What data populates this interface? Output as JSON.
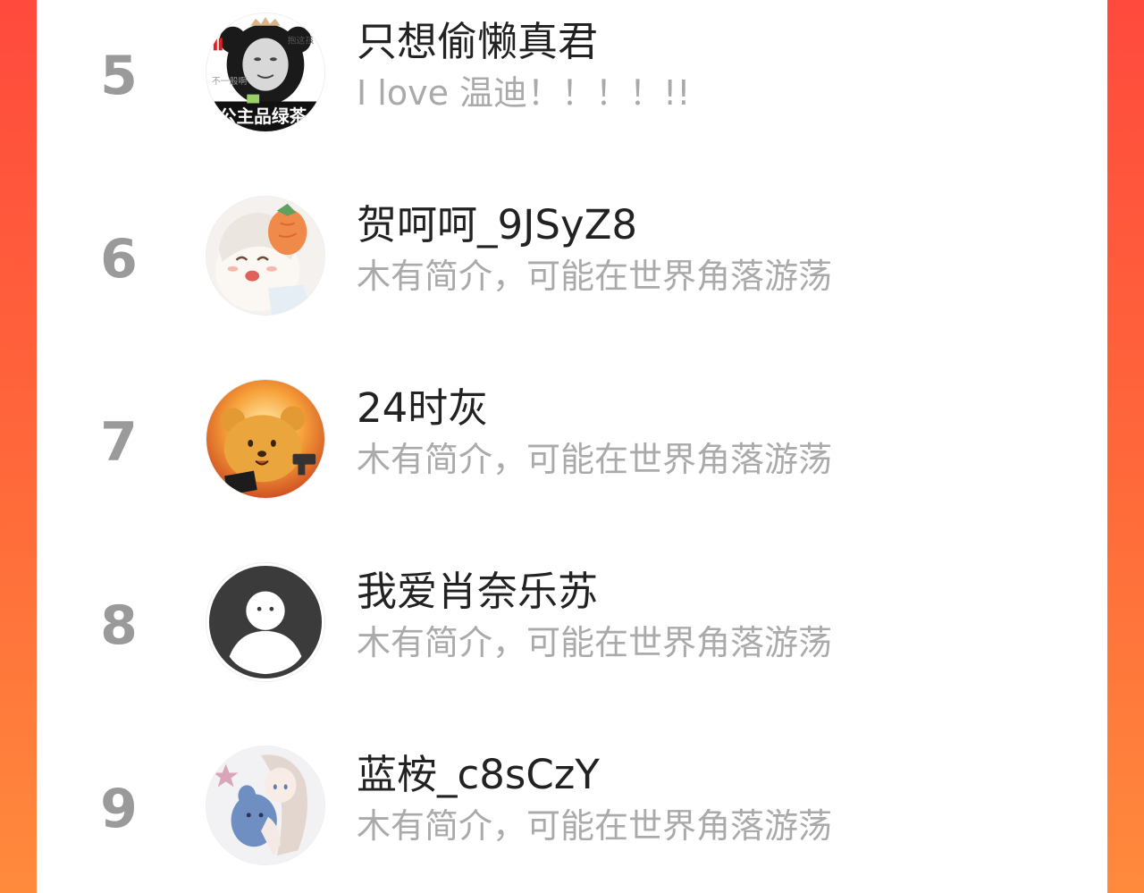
{
  "colors": {
    "background_gradient_top": "#ff4a3d",
    "background_gradient_bottom": "#ff8a3c",
    "card": "#ffffff",
    "rank_text": "#9a9a9a",
    "name_text": "#222222",
    "bio_text": "#aaaaaa"
  },
  "ranking": [
    {
      "rank": "5",
      "name": "只想偷懒真君",
      "bio": "I love 温迪！！！！!!",
      "avatar_icon": "panda-meme-avatar-icon",
      "avatar_text": {
        "top": "抱这孩",
        "left": "不一般啊",
        "bottom": "公主品绿茶"
      }
    },
    {
      "rank": "6",
      "name": "贺呵呵_9JSyZ8",
      "bio": "木有简介，可能在世界角落游荡",
      "avatar_icon": "anime-girl-carrot-avatar-icon"
    },
    {
      "rank": "7",
      "name": "24时灰",
      "bio": "木有简介，可能在世界角落游荡",
      "avatar_icon": "bear-with-gun-fire-avatar-icon"
    },
    {
      "rank": "8",
      "name": "我爱肖奈乐苏",
      "bio": "木有简介，可能在世界角落游荡",
      "avatar_icon": "default-user-avatar-icon"
    },
    {
      "rank": "9",
      "name": "蓝桉_c8sCzY",
      "bio": "木有简介，可能在世界角落游荡",
      "avatar_icon": "anime-girl-hugging-plush-avatar-icon"
    }
  ]
}
